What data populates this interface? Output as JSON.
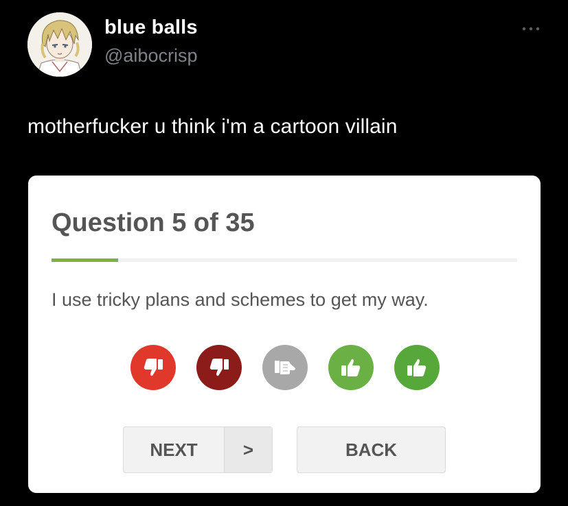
{
  "tweet": {
    "display_name": "blue balls",
    "handle": "@aibocrisp",
    "text": "motherfucker u think i'm a cartoon villain",
    "avatar_icon": "anime-avatar-icon",
    "more_icon": "more-options-icon"
  },
  "quiz": {
    "title": "Question 5 of 35",
    "progress_fraction": 0.143,
    "question": "I use tricky plans and schemes to get my way.",
    "answers": [
      {
        "icon": "thumbs-down-icon",
        "color": "#e0392b"
      },
      {
        "icon": "thumbs-down-icon",
        "color": "#8b1c1a"
      },
      {
        "icon": "thumbs-sideways-icon",
        "color": "#a8a8a8"
      },
      {
        "icon": "thumbs-up-icon",
        "color": "#6ab045"
      },
      {
        "icon": "thumbs-up-icon",
        "color": "#57a83a"
      }
    ],
    "next_label": "NEXT",
    "next_arrow": ">",
    "back_label": "BACK"
  },
  "colors": {
    "background": "#000000",
    "card": "#ffffff",
    "progress": "#7bb342",
    "text_dark": "#555555",
    "handle": "#7d8389"
  }
}
